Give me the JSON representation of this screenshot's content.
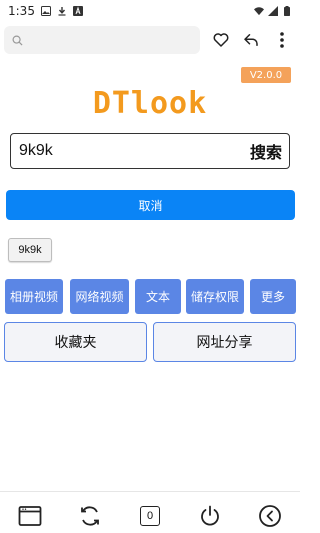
{
  "status_bar": {
    "time": "1:35",
    "icons": [
      "image-icon",
      "download-icon",
      "a-icon",
      "wifi-icon",
      "signal-icon",
      "battery-icon"
    ]
  },
  "browser_toolbar": {
    "search_value": "",
    "icons": [
      "search-icon",
      "heart-icon",
      "share-icon",
      "more-icon"
    ]
  },
  "app": {
    "version": "V2.0.0",
    "logo": "DTlook",
    "search": {
      "value": "9k9k",
      "button_label": "搜索"
    },
    "cancel_label": "取消",
    "history": [
      "9k9k"
    ],
    "actions": [
      "相册视频",
      "网络视频",
      "文本",
      "储存权限",
      "更多"
    ],
    "big_buttons": [
      "收藏夹",
      "网址分享"
    ]
  },
  "bottom_bar": {
    "tab_count": "0",
    "icons": [
      "window-icon",
      "refresh-icon",
      "tabs-icon",
      "power-icon",
      "back-icon"
    ]
  },
  "colors": {
    "accent_blue": "#0a84f6",
    "button_blue": "#5b86e5",
    "logo_orange": "#f39a1e",
    "badge_orange": "#f4a25a"
  }
}
